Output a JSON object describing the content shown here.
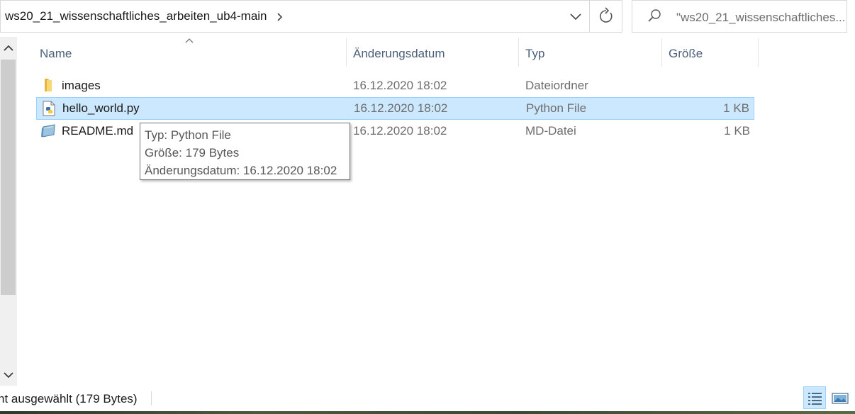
{
  "address_bar": {
    "path": "ws20_21_wissenschaftliches_arbeiten_ub4-main",
    "breadcrumb_icon": "chevron-right-icon",
    "dropdown_icon": "chevron-down-icon",
    "refresh_icon": "refresh-icon"
  },
  "search": {
    "icon": "search-icon",
    "text": "\"ws20_21_wissenschaftliches..."
  },
  "columns": [
    {
      "label": "Name"
    },
    {
      "label": "Änderungsdatum"
    },
    {
      "label": "Typ"
    },
    {
      "label": "Größe"
    }
  ],
  "files": [
    {
      "name": "images",
      "date": "16.12.2020 18:02",
      "type": "Dateiordner",
      "size": "",
      "icon": "folder-icon",
      "selected": false
    },
    {
      "name": "hello_world.py",
      "date": "16.12.2020 18:02",
      "type": "Python File",
      "size": "1 KB",
      "icon": "python-file-icon",
      "selected": true
    },
    {
      "name": "README.md",
      "date": "16.12.2020 18:02",
      "type": "MD-Datei",
      "size": "1 KB",
      "icon": "markdown-file-icon",
      "selected": false
    }
  ],
  "tooltip": {
    "line1": "Typ: Python File",
    "line2": "Größe: 179 Bytes",
    "line3": "Änderungsdatum: 16.12.2020 18:02"
  },
  "status": {
    "text": "nt ausgewählt (179 Bytes)"
  },
  "view_buttons": {
    "details_icon": "details-view-icon",
    "tiles_icon": "large-icons-view-icon"
  },
  "colors": {
    "selection_bg": "#cce8ff",
    "selection_border": "#99d1ff",
    "header_text": "#4c607a",
    "secondary_text": "#6d6d6d"
  }
}
